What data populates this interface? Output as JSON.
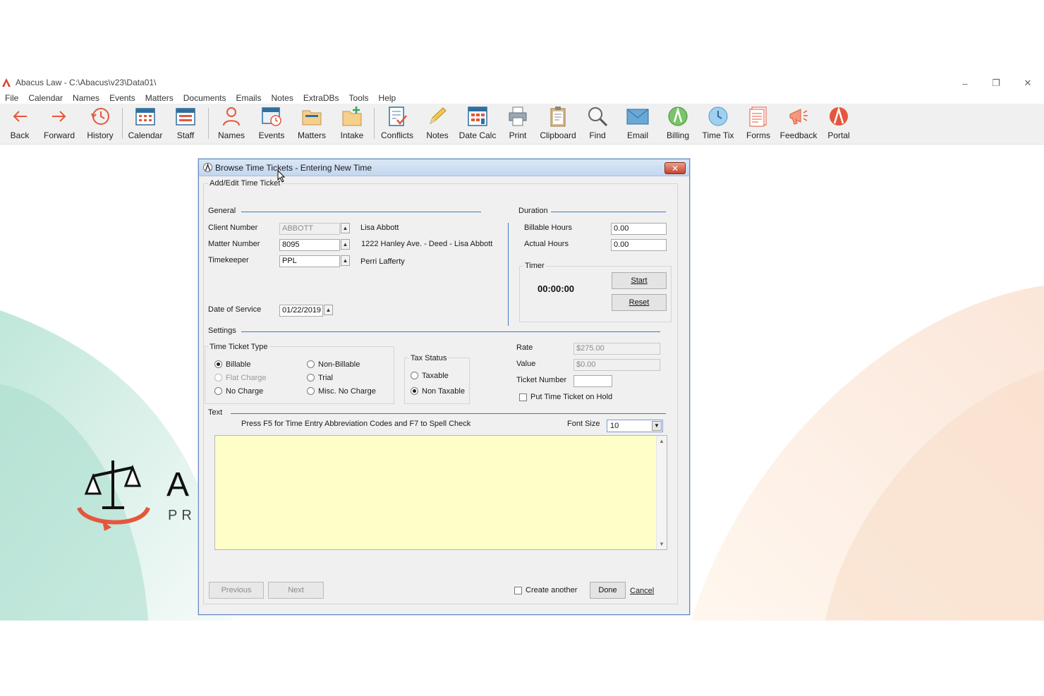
{
  "window": {
    "title": "Abacus Law  -  C:\\Abacus\\v23\\Data01\\",
    "minimize": "–",
    "restore": "❐",
    "close": "✕"
  },
  "menu": [
    "File",
    "Calendar",
    "Names",
    "Events",
    "Matters",
    "Documents",
    "Emails",
    "Notes",
    "ExtraDBs",
    "Tools",
    "Help"
  ],
  "toolbar": {
    "buttons": [
      {
        "label": "Back",
        "icon": "back-arrow-icon"
      },
      {
        "label": "Forward",
        "icon": "forward-arrow-icon"
      },
      {
        "label": "History",
        "icon": "history-icon"
      },
      {
        "label": "Calendar",
        "icon": "calendar-icon"
      },
      {
        "label": "Staff",
        "icon": "staff-calendar-icon"
      },
      {
        "label": "Names",
        "icon": "person-icon"
      },
      {
        "label": "Events",
        "icon": "events-icon"
      },
      {
        "label": "Matters",
        "icon": "folder-icon"
      },
      {
        "label": "Intake",
        "icon": "intake-folder-icon"
      },
      {
        "label": "Conflicts",
        "icon": "conflicts-checklist-icon"
      },
      {
        "label": "Notes",
        "icon": "pencil-icon"
      },
      {
        "label": "Date Calc",
        "icon": "date-calculator-icon"
      },
      {
        "label": "Print",
        "icon": "printer-icon"
      },
      {
        "label": "Clipboard",
        "icon": "clipboard-icon"
      },
      {
        "label": "Find",
        "icon": "magnifier-icon"
      },
      {
        "label": "Email",
        "icon": "envelope-icon"
      },
      {
        "label": "Billing",
        "icon": "billing-icon"
      },
      {
        "label": "Time Tix",
        "icon": "clock-icon"
      },
      {
        "label": "Forms",
        "icon": "forms-icon"
      },
      {
        "label": "Feedback",
        "icon": "megaphone-icon"
      },
      {
        "label": "Portal",
        "icon": "portal-logo-icon"
      }
    ]
  },
  "background": {
    "logo_letter": "A",
    "logo_sub": "PR"
  },
  "dialog": {
    "title": "Browse Time Tickets - Entering New Time",
    "close_label": "✕",
    "group_title": "Add/Edit Time Ticket",
    "general": {
      "heading": "General",
      "client_number_label": "Client Number",
      "client_number_value": "ABBOTT",
      "client_name": "Lisa Abbott",
      "matter_number_label": "Matter Number",
      "matter_number_value": "8095",
      "matter_name": "1222 Hanley Ave. - Deed - Lisa Abbott",
      "timekeeper_label": "Timekeeper",
      "timekeeper_value": "PPL",
      "timekeeper_name": "Perri Lafferty",
      "date_label": "Date of Service",
      "date_value": "01/22/2019"
    },
    "duration": {
      "heading": "Duration",
      "billable_label": "Billable Hours",
      "billable_value": "0.00",
      "actual_label": "Actual Hours",
      "actual_value": "0.00",
      "timer_label": "Timer",
      "timer_value": "00:00:00",
      "start_label": "Start",
      "reset_label": "Reset"
    },
    "settings": {
      "heading": "Settings",
      "type_label": "Time Ticket Type",
      "types": {
        "billable": "Billable",
        "non_billable": "Non-Billable",
        "flat_charge": "Flat Charge",
        "trial": "Trial",
        "no_charge": "No Charge",
        "misc_no_charge": "Misc. No Charge"
      },
      "selected_type": "Billable",
      "tax_label": "Tax Status",
      "taxable": "Taxable",
      "non_taxable": "Non Taxable",
      "selected_tax": "Non Taxable",
      "rate_label": "Rate",
      "rate_value": "$275.00",
      "value_label": "Value",
      "value_value": "$0.00",
      "ticket_label": "Ticket Number",
      "ticket_value": "",
      "hold_label": "Put Time Ticket on Hold"
    },
    "text": {
      "heading": "Text",
      "hint": "Press F5 for Time Entry Abbreviation Codes and F7 to Spell Check",
      "font_size_label": "Font Size",
      "font_size_value": "10",
      "body": ""
    },
    "footer": {
      "previous_label": "Previous",
      "next_label": "Next",
      "create_another_label": "Create another",
      "done_label": "Done",
      "cancel_label": "Cancel"
    }
  }
}
